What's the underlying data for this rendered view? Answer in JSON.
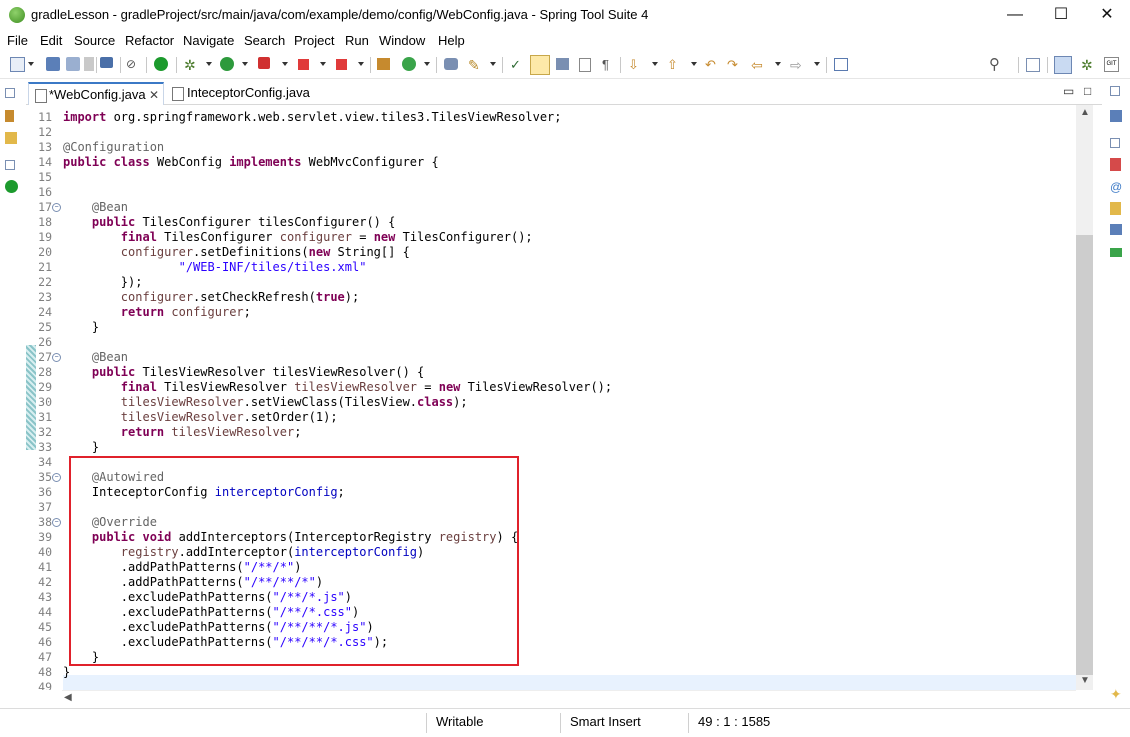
{
  "window": {
    "title": "gradleLesson - gradleProject/src/main/java/com/example/demo/config/WebConfig.java - Spring Tool Suite 4",
    "minimize": "—",
    "maximize": "☐",
    "close": "✕"
  },
  "menu": [
    "File",
    "Edit",
    "Source",
    "Refactor",
    "Navigate",
    "Search",
    "Project",
    "Run",
    "Window",
    "Help"
  ],
  "tabs": [
    {
      "label": "*WebConfig.java",
      "close": "✕",
      "active": true
    },
    {
      "label": "InteceptorConfig.java",
      "active": false
    }
  ],
  "pane_controls": {
    "minimize": "▭",
    "maximize": "□"
  },
  "code_lines": [
    {
      "n": "11",
      "html": "<span class=\"kw\">import</span> org.springframework.web.servlet.view.tiles3.TilesViewResolver;"
    },
    {
      "n": "12",
      "html": ""
    },
    {
      "n": "13",
      "html": "<span class=\"ann\">@Configuration</span>"
    },
    {
      "n": "14",
      "html": "<span class=\"kw\">public class</span> WebConfig <span class=\"kw\">implements</span> WebMvcConfigurer {"
    },
    {
      "n": "15",
      "html": ""
    },
    {
      "n": "16",
      "html": ""
    },
    {
      "n": "17",
      "html": "    <span class=\"ann\">@Bean</span>",
      "fold": true
    },
    {
      "n": "18",
      "html": "    <span class=\"kw\">public</span> TilesConfigurer tilesConfigurer() {"
    },
    {
      "n": "19",
      "html": "        <span class=\"kw\">final</span> TilesConfigurer <span class=\"loc\">configurer</span> = <span class=\"kw\">new</span> TilesConfigurer();"
    },
    {
      "n": "20",
      "html": "        <span class=\"loc\">configurer</span>.setDefinitions(<span class=\"kw\">new</span> String[] {"
    },
    {
      "n": "21",
      "html": "                <span class=\"str\">\"/WEB-INF/tiles/tiles.xml\"</span>"
    },
    {
      "n": "22",
      "html": "        });"
    },
    {
      "n": "23",
      "html": "        <span class=\"loc\">configurer</span>.setCheckRefresh(<span class=\"kw\">true</span>);"
    },
    {
      "n": "24",
      "html": "        <span class=\"kw\">return</span> <span class=\"loc\">configurer</span>;"
    },
    {
      "n": "25",
      "html": "    }"
    },
    {
      "n": "26",
      "html": ""
    },
    {
      "n": "27",
      "html": "    <span class=\"ann\">@Bean</span>",
      "fold": true
    },
    {
      "n": "28",
      "html": "    <span class=\"kw\">public</span> TilesViewResolver tilesViewResolver() {"
    },
    {
      "n": "29",
      "html": "        <span class=\"kw\">final</span> TilesViewResolver <span class=\"loc\">tilesViewResolver</span> = <span class=\"kw\">new</span> TilesViewResolver();"
    },
    {
      "n": "30",
      "html": "        <span class=\"loc\">tilesViewResolver</span>.setViewClass(TilesView.<span class=\"kw\">class</span>);"
    },
    {
      "n": "31",
      "html": "        <span class=\"loc\">tilesViewResolver</span>.setOrder(1);"
    },
    {
      "n": "32",
      "html": "        <span class=\"kw\">return</span> <span class=\"loc\">tilesViewResolver</span>;"
    },
    {
      "n": "33",
      "html": "    }"
    },
    {
      "n": "34",
      "html": ""
    },
    {
      "n": "35",
      "html": "    <span class=\"ann\">@Autowired</span>",
      "fold": true
    },
    {
      "n": "36",
      "html": "    InteceptorConfig <span class=\"fld\">interceptorConfig</span>;"
    },
    {
      "n": "37",
      "html": ""
    },
    {
      "n": "38",
      "html": "    <span class=\"ann\">@Override</span>",
      "fold": true
    },
    {
      "n": "39",
      "html": "    <span class=\"kw\">public void</span> addInterceptors(InterceptorRegistry <span class=\"loc\">registry</span>) {"
    },
    {
      "n": "40",
      "html": "        <span class=\"loc\">registry</span>.addInterceptor(<span class=\"fld\">interceptorConfig</span>)"
    },
    {
      "n": "41",
      "html": "        .addPathPatterns(<span class=\"str\">\"/**/*\"</span>)"
    },
    {
      "n": "42",
      "html": "        .addPathPatterns(<span class=\"str\">\"/**/**/*\"</span>)"
    },
    {
      "n": "43",
      "html": "        .excludePathPatterns(<span class=\"str\">\"/**/*.js\"</span>)"
    },
    {
      "n": "44",
      "html": "        .excludePathPatterns(<span class=\"str\">\"/**/*.css\"</span>)"
    },
    {
      "n": "45",
      "html": "        .excludePathPatterns(<span class=\"str\">\"/**/**/*.js\"</span>)"
    },
    {
      "n": "46",
      "html": "        .excludePathPatterns(<span class=\"str\">\"/**/**/*.css\"</span>);"
    },
    {
      "n": "47",
      "html": "    }"
    },
    {
      "n": "48",
      "html": "}"
    },
    {
      "n": "49",
      "html": ""
    }
  ],
  "status": {
    "writable": "Writable",
    "insert_mode": "Smart Insert",
    "position": "49 : 1 : 1585"
  },
  "colors": {
    "keyword": "#7f0055",
    "annotation": "#646464",
    "string": "#2a00ff",
    "field": "#0000c0",
    "highlight_box": "#e0212b"
  }
}
